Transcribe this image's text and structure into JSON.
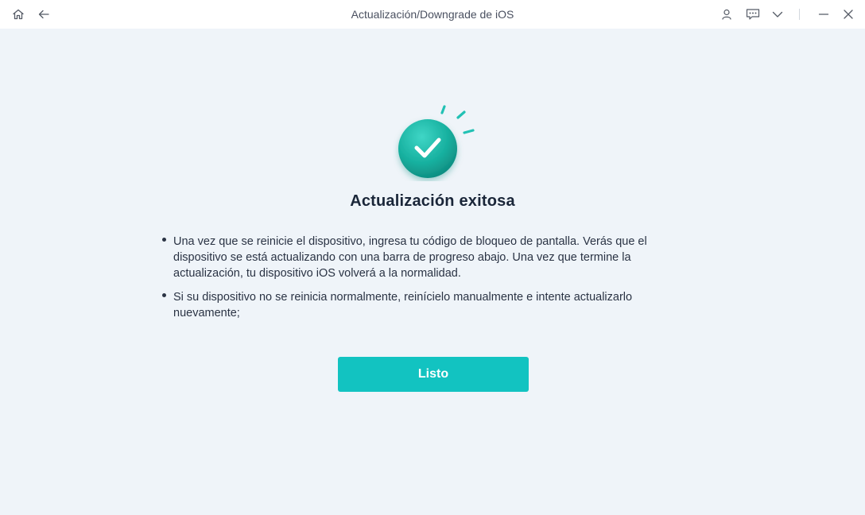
{
  "window": {
    "title": "Actualización/Downgrade de iOS"
  },
  "icons": {
    "home": "home-icon",
    "back": "arrow-left-icon",
    "account": "user-icon",
    "feedback": "chat-icon",
    "menu": "chevron-down-icon",
    "minimize": "minimize-icon",
    "close": "close-icon",
    "success": "check-circle-icon"
  },
  "main": {
    "heading": "Actualización exitosa",
    "bullets": [
      "Una vez que se reinicie el dispositivo, ingresa tu código de bloqueo de pantalla. Verás que el dispositivo se está actualizando con una barra de progreso abajo. Una vez que termine la actualización, tu dispositivo iOS volverá a la normalidad.",
      "Si su dispositivo no se reinicia normalmente, reinícielo manualmente e intente actualizarlo nuevamente;"
    ],
    "done_label": "Listo"
  },
  "colors": {
    "accent": "#12c3c1",
    "success_circle": "#1bb8a8",
    "background": "#eff4f9",
    "titlebar": "#ffffff"
  }
}
